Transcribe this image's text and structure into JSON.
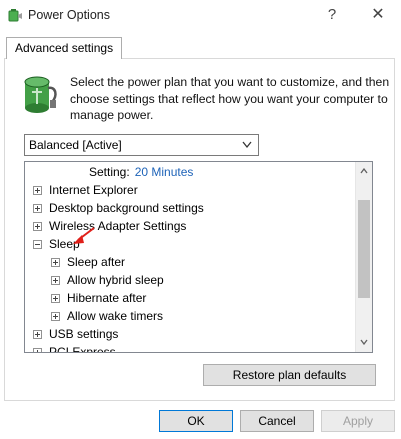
{
  "window": {
    "title": "Power Options",
    "help_glyph": "?",
    "close_glyph": "✕"
  },
  "tabs": [
    {
      "label": "Advanced settings"
    }
  ],
  "intro": {
    "text": "Select the power plan that you want to customize, and then choose settings that reflect how you want your computer to manage power."
  },
  "plan_select": {
    "value": "Balanced [Active]"
  },
  "tree": {
    "setting_label": "Setting:",
    "setting_value": "20 Minutes",
    "items": [
      {
        "label": "Internet Explorer",
        "expanded": false,
        "level": 0
      },
      {
        "label": "Desktop background settings",
        "expanded": false,
        "level": 0
      },
      {
        "label": "Wireless Adapter Settings",
        "expanded": false,
        "level": 0
      },
      {
        "label": "Sleep",
        "expanded": true,
        "level": 0
      },
      {
        "label": "Sleep after",
        "expanded": false,
        "level": 1
      },
      {
        "label": "Allow hybrid sleep",
        "expanded": false,
        "level": 1
      },
      {
        "label": "Hibernate after",
        "expanded": false,
        "level": 1
      },
      {
        "label": "Allow wake timers",
        "expanded": false,
        "level": 1
      },
      {
        "label": "USB settings",
        "expanded": false,
        "level": 0
      },
      {
        "label": "PCI Express",
        "expanded": false,
        "level": 0
      }
    ]
  },
  "buttons": {
    "restore_defaults": "Restore plan defaults",
    "ok": "OK",
    "cancel": "Cancel",
    "apply": "Apply"
  },
  "colors": {
    "setting_value": "#1e63b8",
    "annotation_arrow": "#e0201a",
    "default_button_border": "#0078d7"
  }
}
